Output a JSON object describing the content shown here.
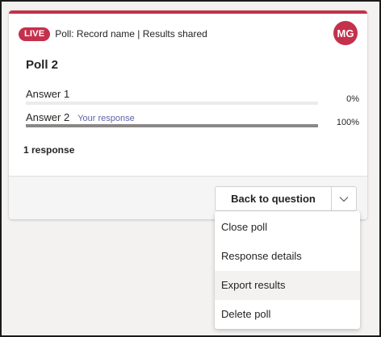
{
  "card": {
    "live_badge": "LIVE",
    "header_text": "Poll: Record name | Results shared",
    "avatar_initials": "MG",
    "poll_title": "Poll 2",
    "answers": [
      {
        "label": "Answer 1",
        "tag": "",
        "percent_text": "0%",
        "fill_fraction": 0.0
      },
      {
        "label": "Answer 2",
        "tag": "Your response",
        "percent_text": "100%",
        "fill_fraction": 1.0
      }
    ],
    "response_count": "1 response"
  },
  "footer": {
    "back_button_label": "Back to question",
    "chevron_icon": "chevron-down-icon"
  },
  "menu": {
    "items": [
      {
        "label": "Close poll"
      },
      {
        "label": "Response details"
      },
      {
        "label": "Export results",
        "highlighted": true
      },
      {
        "label": "Delete poll"
      }
    ]
  },
  "colors": {
    "accent_red": "#c4314b",
    "brand_purple": "#6264a7",
    "bar_fill": "#8a8886",
    "bar_track": "#edebe9"
  }
}
